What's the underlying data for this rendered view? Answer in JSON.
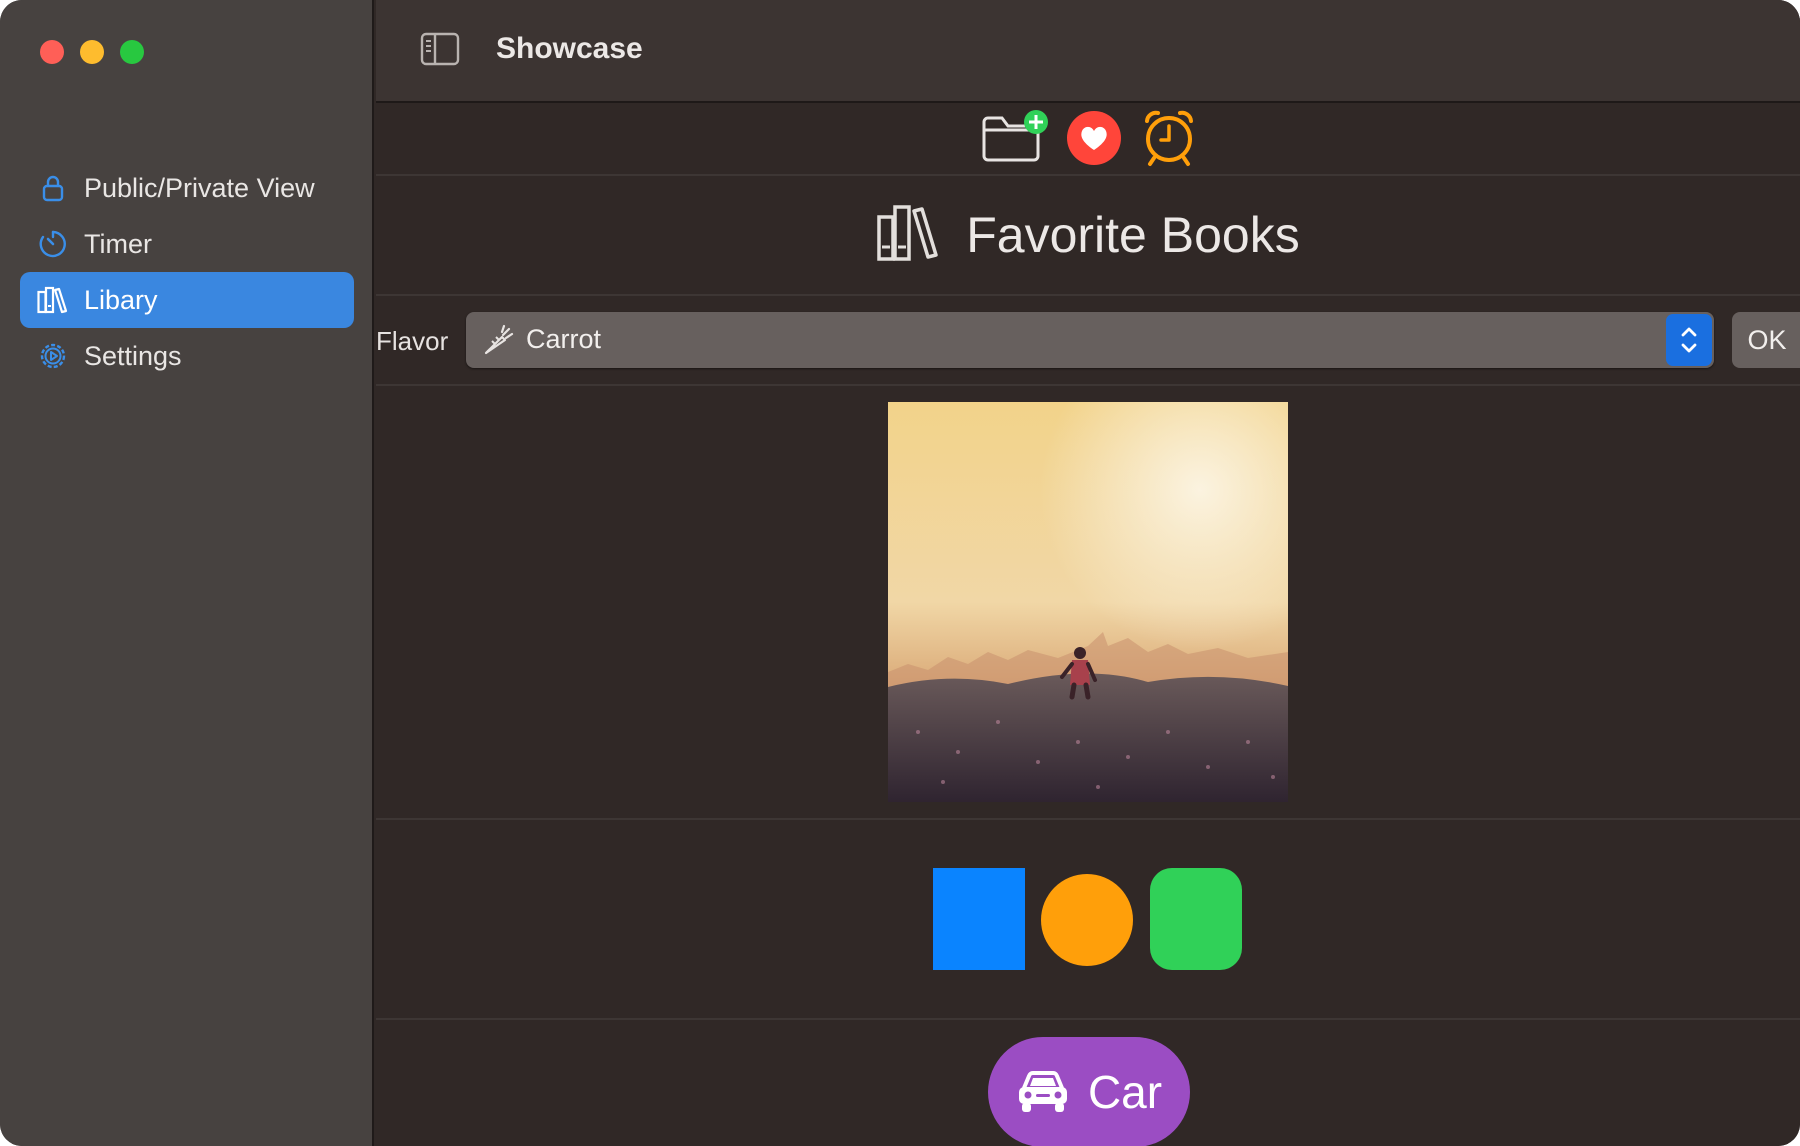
{
  "window": {
    "title": "Showcase"
  },
  "sidebar": {
    "items": [
      {
        "label": "Public/Private View",
        "icon": "lock-icon",
        "active": false
      },
      {
        "label": "Timer",
        "icon": "timer-icon",
        "active": false
      },
      {
        "label": "Libary",
        "icon": "books-icon",
        "active": true
      },
      {
        "label": "Settings",
        "icon": "gear-icon",
        "active": false
      }
    ]
  },
  "toolbar": {
    "icons": [
      "folder-add-icon",
      "heart-icon",
      "alarm-clock-icon"
    ]
  },
  "heading": {
    "text": "Favorite Books",
    "icon": "books-icon"
  },
  "flavor": {
    "label": "Flavor",
    "value": "Carrot",
    "icon": "carrot-icon",
    "ok_label": "OK"
  },
  "image": {
    "description_icon": "photo"
  },
  "shapes": {
    "colors": [
      "#0a84ff",
      "#ff9f0a",
      "#30d158"
    ]
  },
  "car_button": {
    "label": "Car",
    "icon": "car-icon",
    "color": "#9b4dc3"
  },
  "colors": {
    "accent": "#3a87e0",
    "sidebar_bg": "#474240",
    "content_bg": "#302826"
  }
}
